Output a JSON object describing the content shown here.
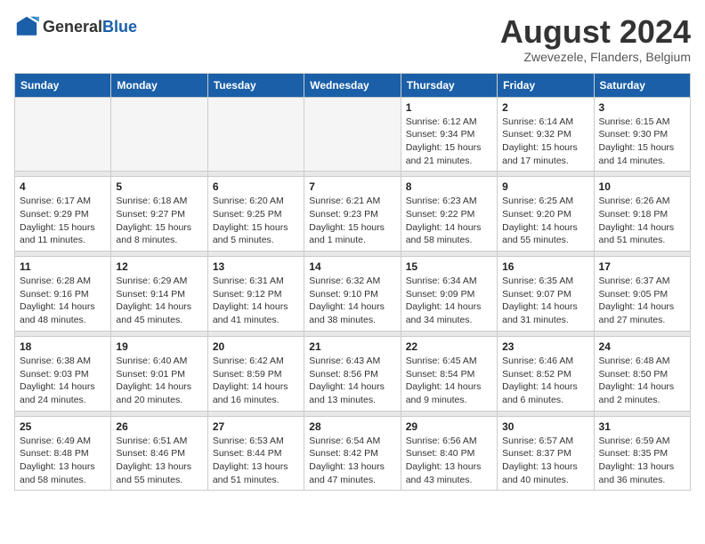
{
  "logo": {
    "text_general": "General",
    "text_blue": "Blue"
  },
  "title": "August 2024",
  "subtitle": "Zwevezele, Flanders, Belgium",
  "days": [
    "Sunday",
    "Monday",
    "Tuesday",
    "Wednesday",
    "Thursday",
    "Friday",
    "Saturday"
  ],
  "weeks": [
    [
      {
        "date": "",
        "info": ""
      },
      {
        "date": "",
        "info": ""
      },
      {
        "date": "",
        "info": ""
      },
      {
        "date": "",
        "info": ""
      },
      {
        "date": "1",
        "info": "Sunrise: 6:12 AM\nSunset: 9:34 PM\nDaylight: 15 hours and 21 minutes."
      },
      {
        "date": "2",
        "info": "Sunrise: 6:14 AM\nSunset: 9:32 PM\nDaylight: 15 hours and 17 minutes."
      },
      {
        "date": "3",
        "info": "Sunrise: 6:15 AM\nSunset: 9:30 PM\nDaylight: 15 hours and 14 minutes."
      }
    ],
    [
      {
        "date": "4",
        "info": "Sunrise: 6:17 AM\nSunset: 9:29 PM\nDaylight: 15 hours and 11 minutes."
      },
      {
        "date": "5",
        "info": "Sunrise: 6:18 AM\nSunset: 9:27 PM\nDaylight: 15 hours and 8 minutes."
      },
      {
        "date": "6",
        "info": "Sunrise: 6:20 AM\nSunset: 9:25 PM\nDaylight: 15 hours and 5 minutes."
      },
      {
        "date": "7",
        "info": "Sunrise: 6:21 AM\nSunset: 9:23 PM\nDaylight: 15 hours and 1 minute."
      },
      {
        "date": "8",
        "info": "Sunrise: 6:23 AM\nSunset: 9:22 PM\nDaylight: 14 hours and 58 minutes."
      },
      {
        "date": "9",
        "info": "Sunrise: 6:25 AM\nSunset: 9:20 PM\nDaylight: 14 hours and 55 minutes."
      },
      {
        "date": "10",
        "info": "Sunrise: 6:26 AM\nSunset: 9:18 PM\nDaylight: 14 hours and 51 minutes."
      }
    ],
    [
      {
        "date": "11",
        "info": "Sunrise: 6:28 AM\nSunset: 9:16 PM\nDaylight: 14 hours and 48 minutes."
      },
      {
        "date": "12",
        "info": "Sunrise: 6:29 AM\nSunset: 9:14 PM\nDaylight: 14 hours and 45 minutes."
      },
      {
        "date": "13",
        "info": "Sunrise: 6:31 AM\nSunset: 9:12 PM\nDaylight: 14 hours and 41 minutes."
      },
      {
        "date": "14",
        "info": "Sunrise: 6:32 AM\nSunset: 9:10 PM\nDaylight: 14 hours and 38 minutes."
      },
      {
        "date": "15",
        "info": "Sunrise: 6:34 AM\nSunset: 9:09 PM\nDaylight: 14 hours and 34 minutes."
      },
      {
        "date": "16",
        "info": "Sunrise: 6:35 AM\nSunset: 9:07 PM\nDaylight: 14 hours and 31 minutes."
      },
      {
        "date": "17",
        "info": "Sunrise: 6:37 AM\nSunset: 9:05 PM\nDaylight: 14 hours and 27 minutes."
      }
    ],
    [
      {
        "date": "18",
        "info": "Sunrise: 6:38 AM\nSunset: 9:03 PM\nDaylight: 14 hours and 24 minutes."
      },
      {
        "date": "19",
        "info": "Sunrise: 6:40 AM\nSunset: 9:01 PM\nDaylight: 14 hours and 20 minutes."
      },
      {
        "date": "20",
        "info": "Sunrise: 6:42 AM\nSunset: 8:59 PM\nDaylight: 14 hours and 16 minutes."
      },
      {
        "date": "21",
        "info": "Sunrise: 6:43 AM\nSunset: 8:56 PM\nDaylight: 14 hours and 13 minutes."
      },
      {
        "date": "22",
        "info": "Sunrise: 6:45 AM\nSunset: 8:54 PM\nDaylight: 14 hours and 9 minutes."
      },
      {
        "date": "23",
        "info": "Sunrise: 6:46 AM\nSunset: 8:52 PM\nDaylight: 14 hours and 6 minutes."
      },
      {
        "date": "24",
        "info": "Sunrise: 6:48 AM\nSunset: 8:50 PM\nDaylight: 14 hours and 2 minutes."
      }
    ],
    [
      {
        "date": "25",
        "info": "Sunrise: 6:49 AM\nSunset: 8:48 PM\nDaylight: 13 hours and 58 minutes."
      },
      {
        "date": "26",
        "info": "Sunrise: 6:51 AM\nSunset: 8:46 PM\nDaylight: 13 hours and 55 minutes."
      },
      {
        "date": "27",
        "info": "Sunrise: 6:53 AM\nSunset: 8:44 PM\nDaylight: 13 hours and 51 minutes."
      },
      {
        "date": "28",
        "info": "Sunrise: 6:54 AM\nSunset: 8:42 PM\nDaylight: 13 hours and 47 minutes."
      },
      {
        "date": "29",
        "info": "Sunrise: 6:56 AM\nSunset: 8:40 PM\nDaylight: 13 hours and 43 minutes."
      },
      {
        "date": "30",
        "info": "Sunrise: 6:57 AM\nSunset: 8:37 PM\nDaylight: 13 hours and 40 minutes."
      },
      {
        "date": "31",
        "info": "Sunrise: 6:59 AM\nSunset: 8:35 PM\nDaylight: 13 hours and 36 minutes."
      }
    ]
  ]
}
